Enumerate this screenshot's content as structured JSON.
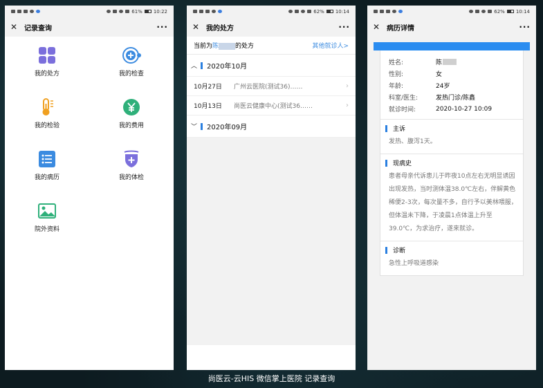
{
  "panel1": {
    "status": {
      "time": "10:22",
      "battery": "61%"
    },
    "title": "记录查询",
    "menu": [
      {
        "label": "我的处方",
        "icon": "grid-apps-icon",
        "color": "#7b6fdc"
      },
      {
        "label": "我的检查",
        "icon": "plus-circle-icon",
        "color": "#3b8be0"
      },
      {
        "label": "我的检验",
        "icon": "thermometer-icon",
        "color": "#f0a020"
      },
      {
        "label": "我的费用",
        "icon": "yuan-coin-icon",
        "color": "#2fb07a"
      },
      {
        "label": "我的病历",
        "icon": "list-document-icon",
        "color": "#3b8be0"
      },
      {
        "label": "我的体检",
        "icon": "shield-plus-icon",
        "color": "#7b6fdc"
      },
      {
        "label": "院外资料",
        "icon": "image-icon",
        "color": "#2fb07a"
      }
    ]
  },
  "panel2": {
    "status": {
      "time": "10:14",
      "battery": "62%"
    },
    "title": "我的处方",
    "current_prefix": "当前为",
    "current_name": "陈",
    "current_suffix": "的处方",
    "other_link": "其他就诊人>",
    "months": [
      {
        "label": "2020年10月",
        "expanded": true,
        "visits": [
          {
            "date": "10月27日",
            "hospital": "广州云医院(测试36)……"
          },
          {
            "date": "10月13日",
            "hospital": "尚医云健康中心(测试36……"
          }
        ]
      },
      {
        "label": "2020年09月",
        "expanded": false,
        "visits": []
      }
    ]
  },
  "panel3": {
    "status": {
      "time": "10:14",
      "battery": "62%"
    },
    "title": "病历详情",
    "info": [
      {
        "key": "姓名:",
        "value": "陈"
      },
      {
        "key": "性别:",
        "value": "女"
      },
      {
        "key": "年龄:",
        "value": "24岁"
      },
      {
        "key": "科室/医生:",
        "value": "发热门诊/陈鑫"
      },
      {
        "key": "就诊时间:",
        "value": "2020-10-27 10:09"
      }
    ],
    "sections": [
      {
        "title": "主诉",
        "body": "发热、腹泻1天。"
      },
      {
        "title": "现病史",
        "body": "患者母亲代诉患儿于昨夜10点左右无明显诱因出现发热，当时测体温38.0℃左右，伴解黄色稀便2-3次，每次量不多，自行予以美林喂服，但体温未下降，于凌晨1点体温上升至39.0℃，为求治疗，遂来就诊。"
      },
      {
        "title": "诊断",
        "body": "急性上呼吸道感染"
      }
    ]
  },
  "caption": "尚医云-云HIS 微信掌上医院 记录查询"
}
